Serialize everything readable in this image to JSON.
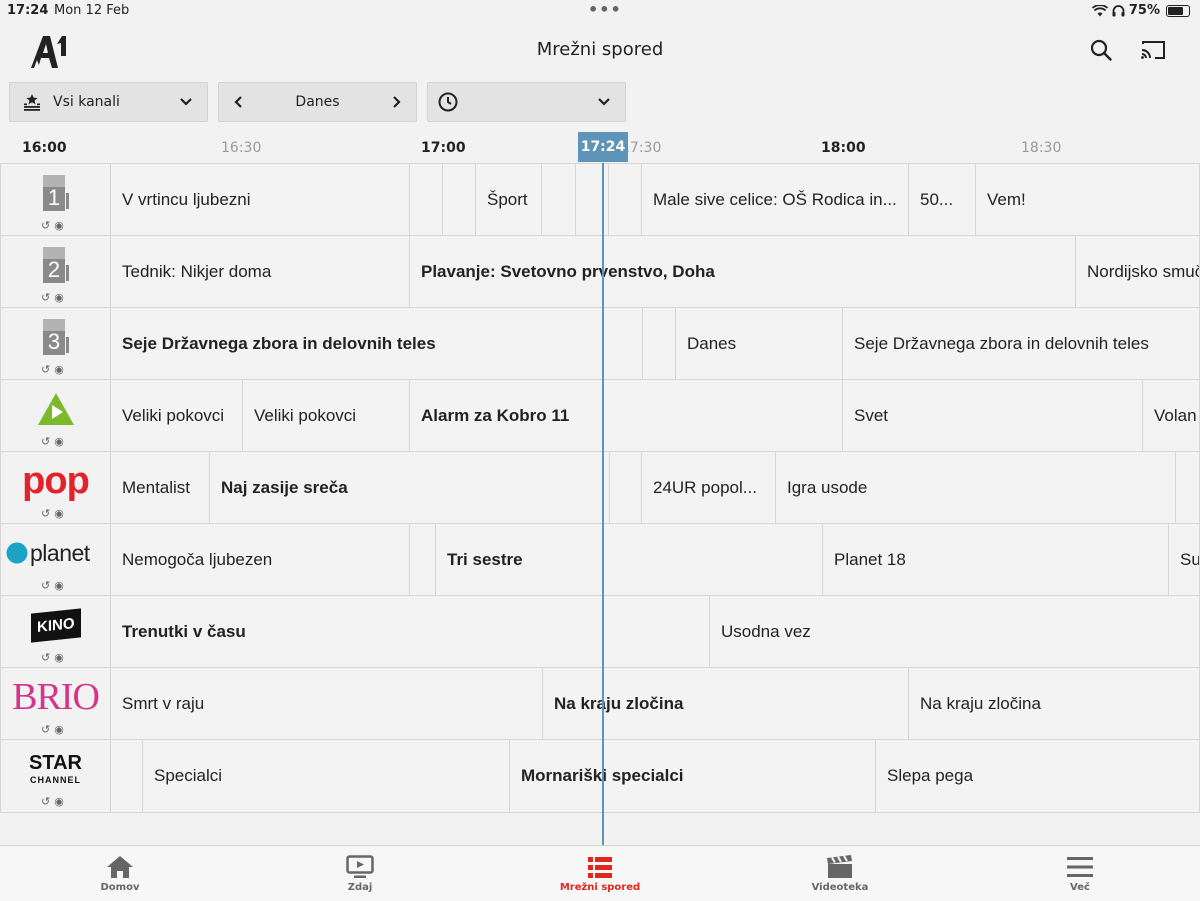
{
  "status_bar": {
    "time": "17:24",
    "date": "Mon 12 Feb",
    "battery": "75%",
    "battery_level": 0.75
  },
  "header": {
    "title": "Mrežni spored"
  },
  "filters": {
    "channels": "Vsi kanali",
    "day": "Danes"
  },
  "timeline": {
    "ticks": [
      "16:00",
      "16:30",
      "17:00",
      "17:30",
      "18:00",
      "18:30"
    ],
    "now": "17:24"
  },
  "channels": [
    {
      "name": "SLO 1",
      "programs": [
        {
          "title": "V vrtincu ljubezni"
        },
        {
          "title": ""
        },
        {
          "title": ""
        },
        {
          "title": "Šport"
        },
        {
          "title": ""
        },
        {
          "title": ""
        },
        {
          "title": ""
        },
        {
          "title": "Male sive celice: OŠ Rodica in..."
        },
        {
          "title": "50..."
        },
        {
          "title": "Vem!"
        }
      ]
    },
    {
      "name": "SLO 2",
      "programs": [
        {
          "title": "Tednik: Nikjer doma"
        },
        {
          "title": "Plavanje: Svetovno prvenstvo, Doha"
        },
        {
          "title": "Nordijsko smuč"
        }
      ]
    },
    {
      "name": "SLO 3",
      "programs": [
        {
          "title": "Seje Državnega zbora in delovnih teles"
        },
        {
          "title": ""
        },
        {
          "title": "Danes"
        },
        {
          "title": "Seje Državnega zbora in delovnih teles"
        }
      ]
    },
    {
      "name": "Kanal A",
      "programs": [
        {
          "title": "Veliki pokovci"
        },
        {
          "title": "Veliki pokovci"
        },
        {
          "title": "Alarm za Kobro 11"
        },
        {
          "title": "Svet"
        },
        {
          "title": "Volan"
        }
      ]
    },
    {
      "name": "POP",
      "logo_text": "pop",
      "programs": [
        {
          "title": "Mentalist"
        },
        {
          "title": "Naj zasije sreča"
        },
        {
          "title": ""
        },
        {
          "title": "24UR popol..."
        },
        {
          "title": "Igra usode"
        },
        {
          "title": ""
        }
      ]
    },
    {
      "name": "Planet",
      "logo_text": "planet",
      "programs": [
        {
          "title": "Nemogoča ljubezen"
        },
        {
          "title": ""
        },
        {
          "title": "Tri sestre"
        },
        {
          "title": "Planet 18"
        },
        {
          "title": "Su"
        }
      ]
    },
    {
      "name": "Kino",
      "logo_text": "KINO",
      "programs": [
        {
          "title": "Trenutki v času"
        },
        {
          "title": "Usodna vez"
        }
      ]
    },
    {
      "name": "Brio",
      "logo_text": "BRIO",
      "programs": [
        {
          "title": "Smrt v raju"
        },
        {
          "title": "Na kraju zločina"
        },
        {
          "title": "Na kraju zločina"
        }
      ]
    },
    {
      "name": "Star Channel",
      "logo_text": "STAR",
      "logo_sub": "CHANNEL",
      "programs": [
        {
          "title": ""
        },
        {
          "title": "Specialci"
        },
        {
          "title": "Mornariški specialci"
        },
        {
          "title": "Slepa pega"
        }
      ]
    }
  ],
  "tabs": [
    {
      "label": "Domov",
      "icon": "home-icon"
    },
    {
      "label": "Zdaj",
      "icon": "tv-icon"
    },
    {
      "label": "Mrežni spored",
      "icon": "list-icon",
      "active": true
    },
    {
      "label": "Videoteka",
      "icon": "clapper-icon"
    },
    {
      "label": "Več",
      "icon": "menu-icon"
    }
  ],
  "colors": {
    "accent": "#e0271c",
    "now": "#5f93b8",
    "pop": "#e5222a",
    "brio": "#d6338a"
  }
}
